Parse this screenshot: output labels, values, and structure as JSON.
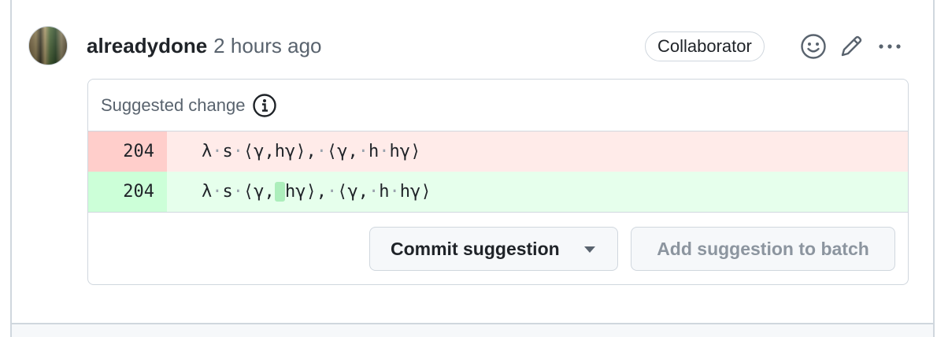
{
  "comment": {
    "author": "alreadydone",
    "timestamp": "2 hours ago",
    "role_badge": "Collaborator",
    "avatar_icon": "user-avatar",
    "actions": [
      "smiley-icon",
      "pencil-icon",
      "kebab-horizontal-icon"
    ]
  },
  "suggestion": {
    "title": "Suggested change",
    "info_icon": "info-icon",
    "deleted_line": {
      "number": "204",
      "tokens": [
        "λ",
        "s",
        "⟨γ,hγ⟩,",
        "⟨γ,",
        "h",
        "hγ⟩"
      ]
    },
    "added_line": {
      "number": "204",
      "tokens": [
        "λ",
        "s",
        "⟨γ,",
        "hγ⟩,",
        "⟨γ,",
        "h",
        "hγ⟩"
      ]
    },
    "commit_label": "Commit suggestion",
    "batch_label": "Add suggestion to batch"
  },
  "colors": {
    "deletion_bg": "#ffebe9",
    "deletion_num_bg": "#ffcecb",
    "addition_bg": "#e6ffec",
    "addition_num_bg": "#ccffd8",
    "highlight": "#aceebb"
  }
}
